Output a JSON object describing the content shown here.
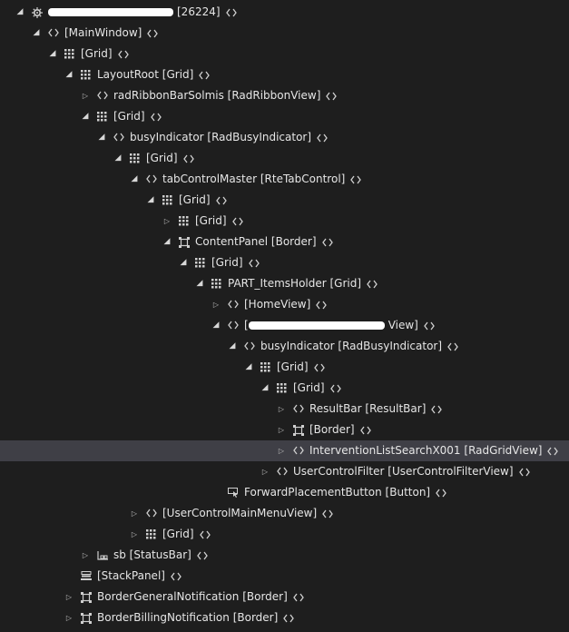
{
  "tree": {
    "rows": [
      {
        "depth": 0,
        "expander": "expanded",
        "icon": "gear-icon",
        "label": "[26224]",
        "redacted": true
      },
      {
        "depth": 1,
        "expander": "expanded",
        "icon": "code-icon",
        "label": "[MainWindow]"
      },
      {
        "depth": 2,
        "expander": "expanded",
        "icon": "grid-icon",
        "label": "[Grid]"
      },
      {
        "depth": 3,
        "expander": "expanded",
        "icon": "grid-icon",
        "label": "LayoutRoot [Grid]"
      },
      {
        "depth": 4,
        "expander": "collapsed",
        "icon": "code-icon",
        "label": "radRibbonBarSolmis [RadRibbonView]"
      },
      {
        "depth": 4,
        "expander": "expanded",
        "icon": "grid-icon",
        "label": "[Grid]"
      },
      {
        "depth": 5,
        "expander": "expanded",
        "icon": "code-icon",
        "label": "busyIndicator [RadBusyIndicator]"
      },
      {
        "depth": 6,
        "expander": "expanded",
        "icon": "grid-icon",
        "label": "[Grid]"
      },
      {
        "depth": 7,
        "expander": "expanded",
        "icon": "code-icon",
        "label": "tabControlMaster [RteTabControl]"
      },
      {
        "depth": 8,
        "expander": "expanded",
        "icon": "grid-icon",
        "label": "[Grid]"
      },
      {
        "depth": 9,
        "expander": "collapsed",
        "icon": "grid-icon",
        "label": "[Grid]"
      },
      {
        "depth": 9,
        "expander": "expanded",
        "icon": "border-icon",
        "label": "ContentPanel [Border]"
      },
      {
        "depth": 10,
        "expander": "expanded",
        "icon": "grid-icon",
        "label": "[Grid]"
      },
      {
        "depth": 11,
        "expander": "expanded",
        "icon": "grid-icon",
        "label": "PART_ItemsHolder [Grid]"
      },
      {
        "depth": 12,
        "expander": "collapsed",
        "icon": "code-icon",
        "label": "[HomeView]"
      },
      {
        "depth": 12,
        "expander": "expanded",
        "icon": "code-icon",
        "label": "View]",
        "redacted_prefix": true
      },
      {
        "depth": 13,
        "expander": "expanded",
        "icon": "code-icon",
        "label": "busyIndicator [RadBusyIndicator]"
      },
      {
        "depth": 14,
        "expander": "expanded",
        "icon": "grid-icon",
        "label": "[Grid]"
      },
      {
        "depth": 15,
        "expander": "expanded",
        "icon": "grid-icon",
        "label": "[Grid]"
      },
      {
        "depth": 16,
        "expander": "collapsed",
        "icon": "code-icon",
        "label": "ResultBar [ResultBar]"
      },
      {
        "depth": 16,
        "expander": "collapsed",
        "icon": "border-icon",
        "label": "[Border]"
      },
      {
        "depth": 16,
        "expander": "collapsed",
        "icon": "code-icon",
        "label": "InterventionListSearchX001 [RadGridView]",
        "selected": true
      },
      {
        "depth": 15,
        "expander": "collapsed",
        "icon": "code-icon",
        "label": "UserControlFilter [UserControlFilterView]"
      },
      {
        "depth": 12,
        "expander": "none",
        "icon": "button-icon",
        "label": "ForwardPlacementButton [Button]"
      },
      {
        "depth": 7,
        "expander": "collapsed",
        "icon": "code-icon",
        "label": "[UserControlMainMenuView]"
      },
      {
        "depth": 7,
        "expander": "collapsed",
        "icon": "grid-icon",
        "label": "[Grid]"
      },
      {
        "depth": 4,
        "expander": "collapsed",
        "icon": "statusbar-icon",
        "label": "sb [StatusBar]"
      },
      {
        "depth": 3,
        "expander": "none",
        "icon": "stackpanel-icon",
        "label": "[StackPanel]"
      },
      {
        "depth": 3,
        "expander": "collapsed",
        "icon": "border-icon",
        "label": "BorderGeneralNotification [Border]"
      },
      {
        "depth": 3,
        "expander": "collapsed",
        "icon": "border-icon",
        "label": "BorderBillingNotification [Border]"
      }
    ]
  }
}
